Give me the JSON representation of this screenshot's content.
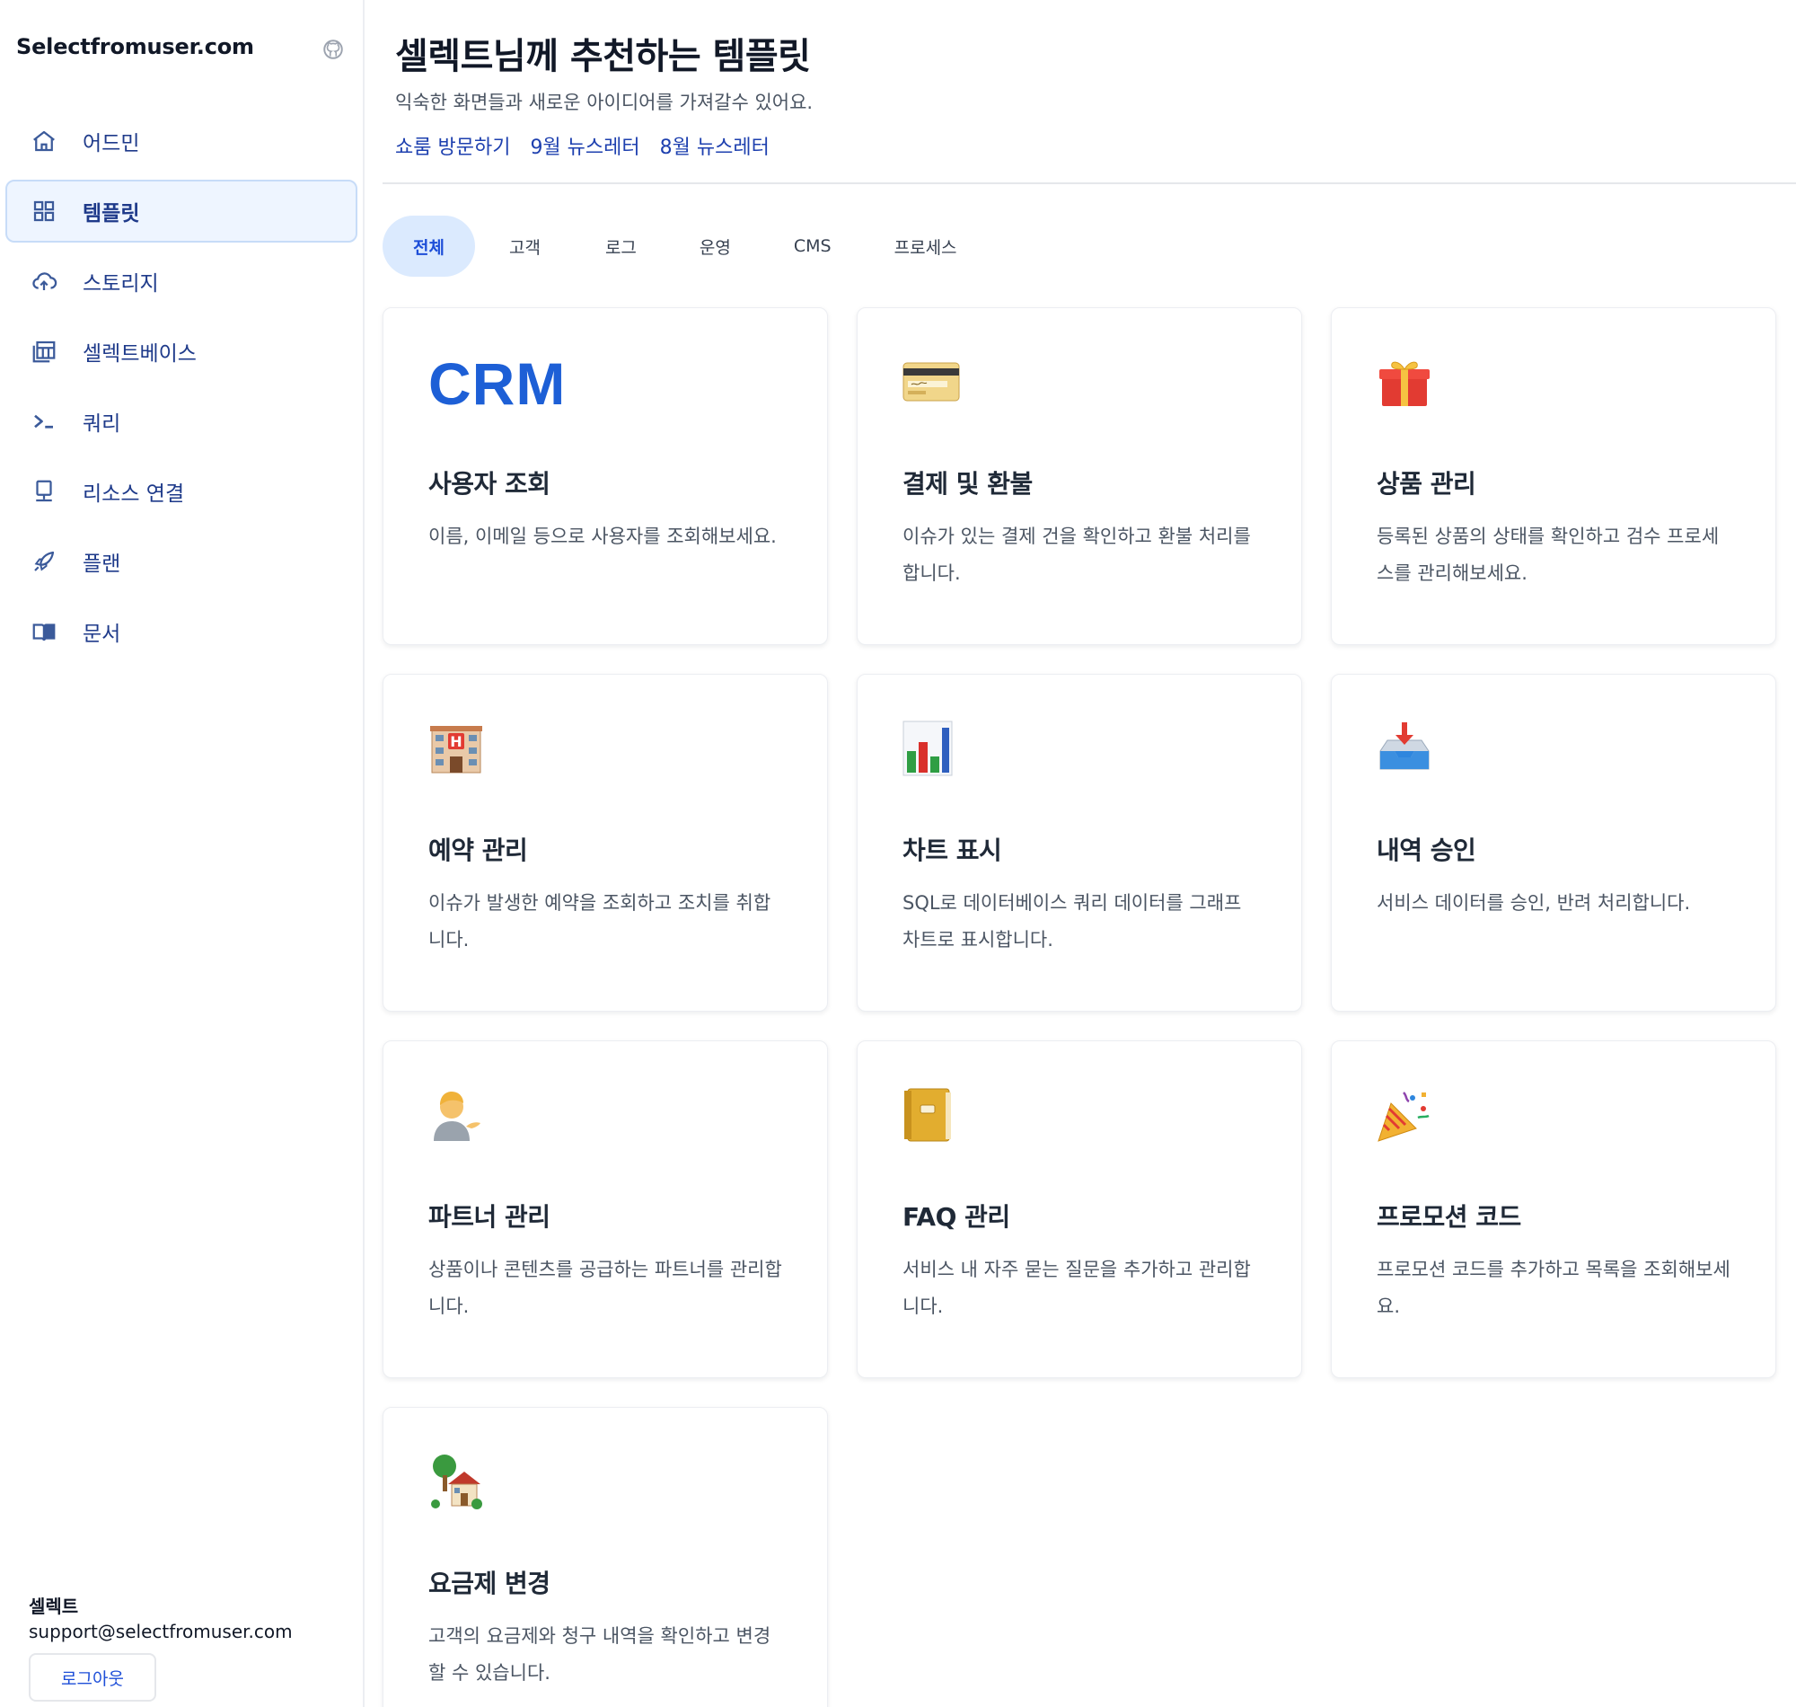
{
  "sidebar": {
    "brand": "Selectfromuser.com",
    "items": [
      {
        "label": "어드민",
        "icon": "home-icon",
        "active": false
      },
      {
        "label": "템플릿",
        "icon": "grid-icon",
        "active": true
      },
      {
        "label": "스토리지",
        "icon": "cloud-upload-icon",
        "active": false
      },
      {
        "label": "셀렉트베이스",
        "icon": "table-icon",
        "active": false
      },
      {
        "label": "쿼리",
        "icon": "terminal-icon",
        "active": false
      },
      {
        "label": "리소스 연결",
        "icon": "monitor-icon",
        "active": false
      },
      {
        "label": "플랜",
        "icon": "rocket-icon",
        "active": false
      },
      {
        "label": "문서",
        "icon": "book-icon",
        "active": false
      }
    ],
    "account": {
      "name": "셀렉트",
      "email": "support@selectfromuser.com",
      "logout_label": "로그아웃"
    }
  },
  "header": {
    "title": "셀렉트님께 추천하는 템플릿",
    "subtitle": "익숙한 화면들과 새로운 아이디어를 가져갈수 있어요.",
    "links": [
      "쇼룸 방문하기",
      "9월 뉴스레터",
      "8월 뉴스레터"
    ]
  },
  "tabs": [
    "전체",
    "고객",
    "로그",
    "운영",
    "CMS",
    "프로세스"
  ],
  "active_tab": "전체",
  "cards": [
    {
      "icon": "crm-text",
      "icon_text": "CRM",
      "title": "사용자 조회",
      "desc": "이름, 이메일 등으로 사용자를 조회해보세요."
    },
    {
      "icon": "credit-card-icon",
      "title": "결제 및 환불",
      "desc": "이슈가 있는 결제 건을 확인하고 환불 처리를 합니다."
    },
    {
      "icon": "gift-icon",
      "title": "상품 관리",
      "desc": "등록된 상품의 상태를 확인하고 검수 프로세스를 관리해보세요."
    },
    {
      "icon": "hotel-icon",
      "title": "예약 관리",
      "desc": "이슈가 발생한 예약을 조회하고 조치를 취합니다."
    },
    {
      "icon": "bar-chart-icon",
      "title": "차트 표시",
      "desc": "SQL로 데이터베이스 쿼리 데이터를 그래프 차트로 표시합니다."
    },
    {
      "icon": "inbox-tray-icon",
      "title": "내역 승인",
      "desc": "서비스 데이터를 승인, 반려 처리합니다."
    },
    {
      "icon": "person-tipping-hand-icon",
      "title": "파트너 관리",
      "desc": "상품이나 콘텐츠를 공급하는 파트너를 관리합니다."
    },
    {
      "icon": "notebook-icon",
      "title": "FAQ 관리",
      "desc": "서비스 내 자주 묻는 질문을 추가하고 관리합니다."
    },
    {
      "icon": "party-popper-icon",
      "title": "프로모션 코드",
      "desc": "프로모션 코드를 추가하고 목록을 조회해보세요."
    },
    {
      "icon": "house-with-garden-icon",
      "title": "요금제 변경",
      "desc": "고객의 요금제와 청구 내역을 확인하고 변경할 수 있습니다."
    }
  ]
}
